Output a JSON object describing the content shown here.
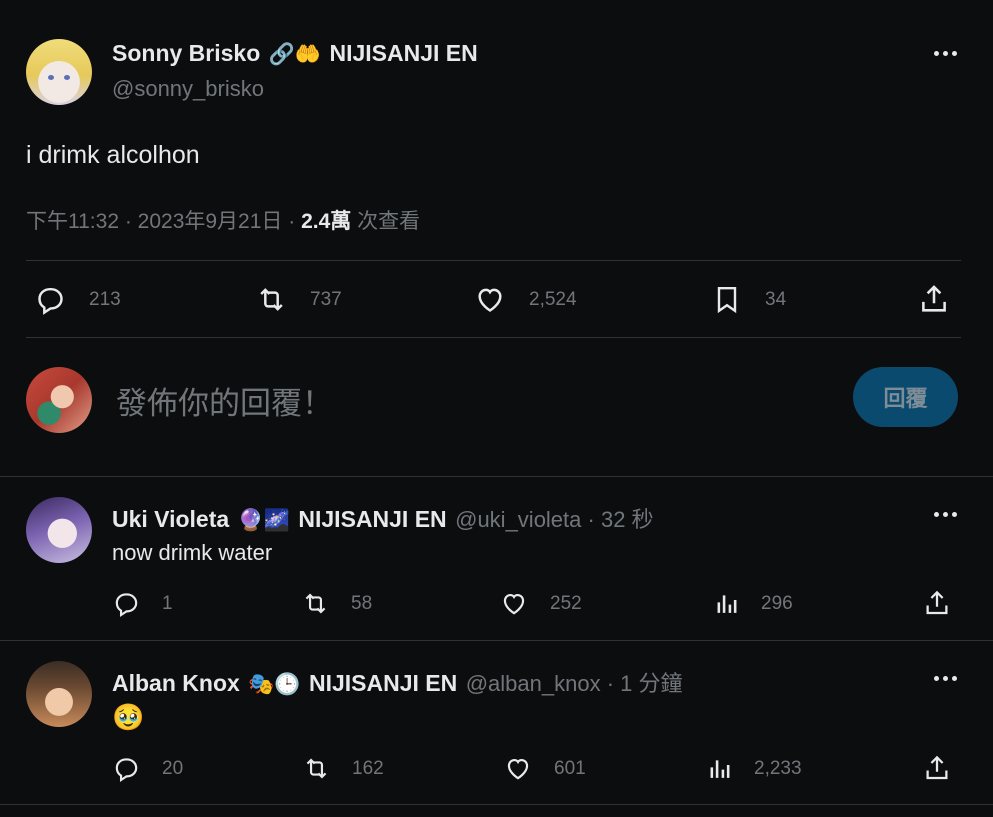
{
  "main_tweet": {
    "author_name": "Sonny Brisko",
    "badge_emojis": "🔗🤲",
    "affiliation": "NIJISANJI EN",
    "handle": "@sonny_brisko",
    "text": "i drimk alcolhon",
    "time": "下午11:32 · 2023年9月21日 · ",
    "views_count": "2.4萬",
    "views_label": " 次查看",
    "stats": {
      "replies": "213",
      "retweets": "737",
      "likes": "2,524",
      "bookmarks": "34"
    }
  },
  "composer": {
    "placeholder": "發佈你的回覆！",
    "reply_button": "回覆"
  },
  "replies": [
    {
      "author_name": "Uki Violeta",
      "badge_emojis": "🔮🌌",
      "affiliation": "NIJISANJI EN",
      "handle": "@uki_violeta",
      "time": " · 32 秒",
      "text": "now drimk water",
      "stats": {
        "replies": "1",
        "retweets": "58",
        "likes": "252",
        "views": "296"
      }
    },
    {
      "author_name": "Alban Knox",
      "badge_emojis": "🎭🕒",
      "affiliation": "NIJISANJI EN",
      "handle": "@alban_knox",
      "time": " · 1 分鐘",
      "text": "🥹",
      "stats": {
        "replies": "20",
        "retweets": "162",
        "likes": "601",
        "views": "2,233"
      }
    }
  ],
  "colors": {
    "background": "#0c0d0f",
    "text": "#e7e9ea",
    "muted": "#71767b",
    "divider": "#2f3336",
    "reply_button_bg": "#0b4a6f",
    "reply_button_text": "#7d8c96"
  }
}
